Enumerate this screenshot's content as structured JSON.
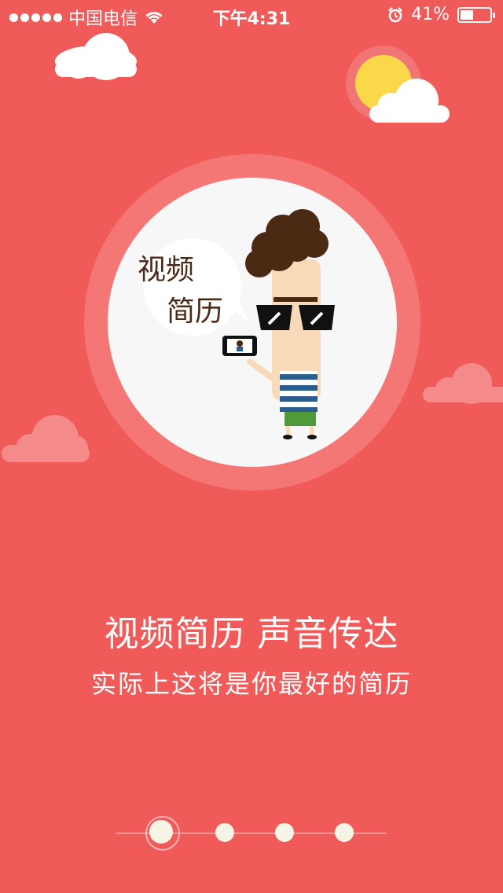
{
  "status_bar": {
    "carrier": "中国电信",
    "time": "下午4:31",
    "battery_percent": "41%",
    "battery_level": 0.41,
    "icons": [
      "signal-dots-icon",
      "wifi-icon",
      "alarm-icon",
      "battery-icon"
    ]
  },
  "illustration": {
    "speech_bubble_line1": "视频",
    "speech_bubble_line2": "简历"
  },
  "content": {
    "title": "视频简历 声音传达",
    "subtitle": "实际上这将是你最好的简历"
  },
  "pager": {
    "total": 4,
    "active_index": 0
  },
  "colors": {
    "background": "#f05a59",
    "circle_outer": "#f47776",
    "circle_inner": "#f7f7f7",
    "cloud": "#ffffff",
    "cloud_pink": "#f58a8a",
    "sun": "#fbd84a",
    "dot": "#f6f4e6"
  }
}
